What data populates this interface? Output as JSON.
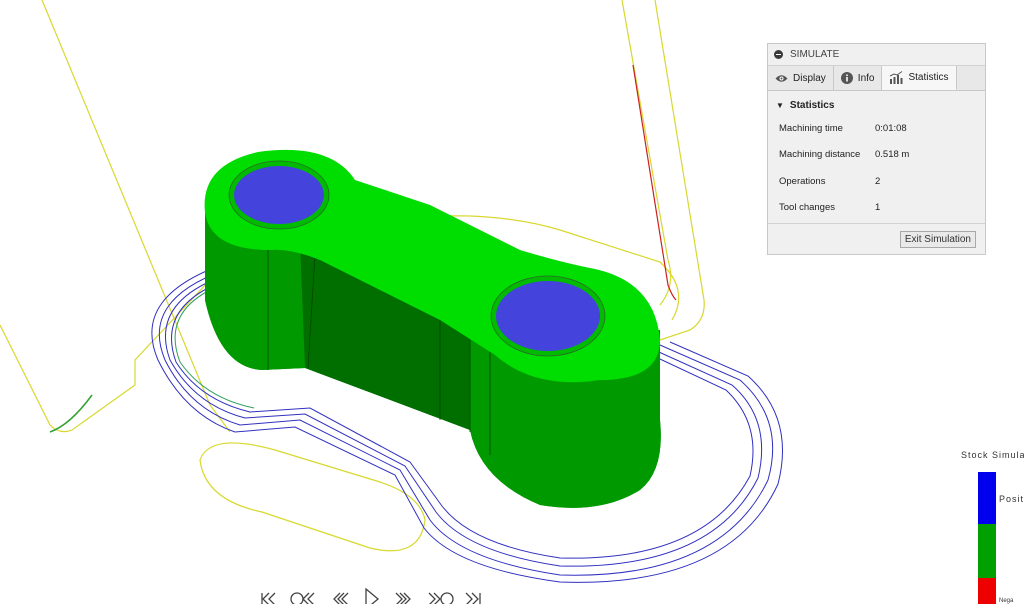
{
  "panel": {
    "title": "SIMULATE",
    "tabs": [
      {
        "label": "Display",
        "icon": "eye-icon"
      },
      {
        "label": "Info",
        "icon": "info-icon"
      },
      {
        "label": "Statistics",
        "icon": "statistics-chart-icon"
      }
    ],
    "active_tab": "Statistics",
    "section_title": "Statistics",
    "stats": [
      {
        "label": "Machining time",
        "value": "0:01:08"
      },
      {
        "label": "Machining distance",
        "value": "0.518 m"
      },
      {
        "label": "Operations",
        "value": "2"
      },
      {
        "label": "Tool changes",
        "value": "1"
      }
    ],
    "exit_label": "Exit Simulation"
  },
  "legend": {
    "title": "Stock Simula",
    "positive_label": "Posit",
    "negative_label": "Nega",
    "colors": [
      "#0000ee",
      "#00a000",
      "#ee0000"
    ]
  },
  "playback": {
    "buttons": [
      "skip-to-start-icon",
      "step-back-icon",
      "rewind-icon",
      "play-icon",
      "fast-forward-icon",
      "step-forward-icon",
      "skip-to-end-icon"
    ]
  },
  "colors": {
    "part_green": "#00dd00",
    "hole_blue": "#4444dd",
    "toolpath_blue": "#3030c0",
    "toolpath_yellow": "#d8d830",
    "rapid_red": "#cc2020"
  }
}
